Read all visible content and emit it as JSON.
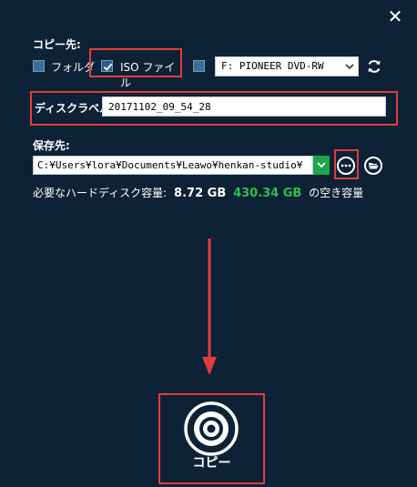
{
  "window": {
    "close_glyph": "✕"
  },
  "copy_destination": {
    "label": "コピー先:",
    "options": [
      {
        "label": "フォルダ",
        "checked": false
      },
      {
        "label": "ISO ファイル",
        "checked": true
      },
      {
        "label": "",
        "checked": false
      }
    ],
    "drive_select": {
      "value": "F: PIONEER  DVD-RW"
    }
  },
  "disk_label": {
    "label": "ディスクラベル:",
    "value": "20171102_09_54_28"
  },
  "save_destination": {
    "label": "保存先:",
    "path": "C:¥Users¥lora¥Documents¥Leawo¥henkan-studio¥"
  },
  "disk_space": {
    "prefix": "必要なハードディスク容量:",
    "required": "8.72 GB",
    "free": "430.34 GB",
    "suffix": "の空き容量"
  },
  "copy_button": {
    "label": "コピー"
  },
  "colors": {
    "background": "#0d2236",
    "highlight": "#e23d3d",
    "accent_green": "#2fbf4e",
    "arrow": "#e23d3d"
  }
}
